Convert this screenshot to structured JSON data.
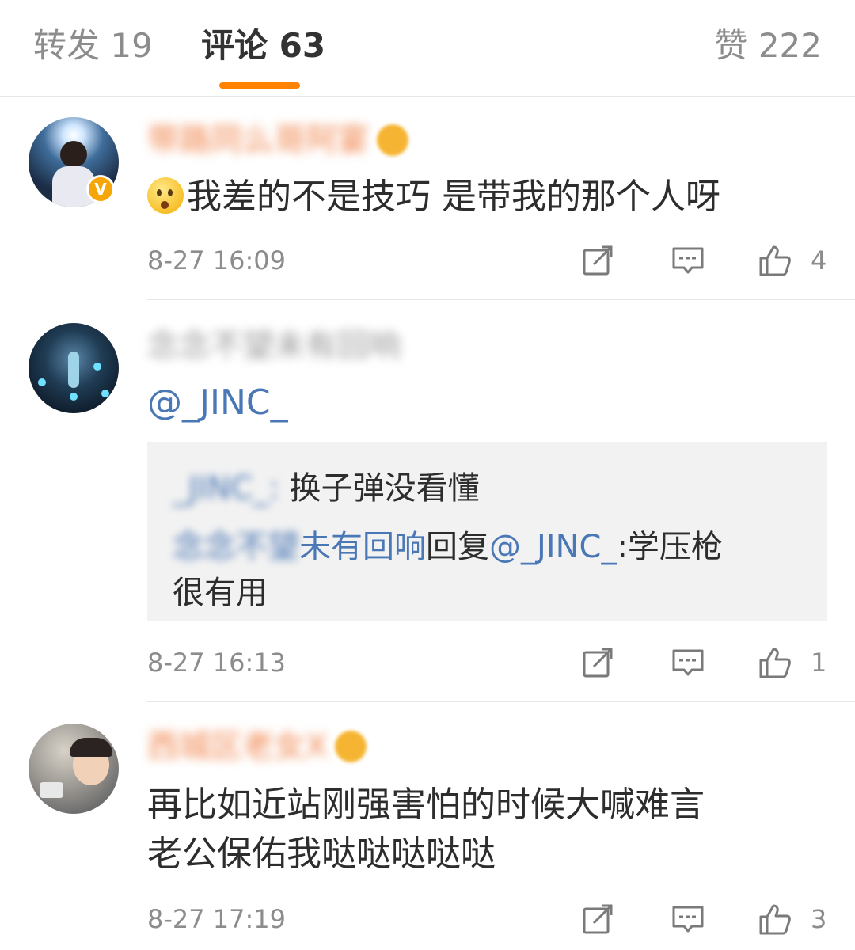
{
  "tabs": {
    "repost": "转发 19",
    "comments": "评论 63",
    "likes": "赞 222",
    "accent_color": "#ff8200"
  },
  "comments": [
    {
      "username": "带路同么哥阿宴",
      "verified_badge": "V",
      "emoji_icon": "thinking-face",
      "text": "我差的不是技巧 是带我的那个人呀",
      "time": "8-27 16:09",
      "like_count": "4"
    },
    {
      "username": "念念不望未有回响",
      "mention": "@_JINC_",
      "quote": {
        "line1_user": "_JINC_:",
        "line1_text": " 换子弹没看懂",
        "line2_user_blur": "念念不望",
        "line2_user_visible": "未有回响",
        "line2_reply": "回复",
        "line2_mention": "@_JINC_",
        "line2_text": ":学压枪",
        "line3_text": "很有用"
      },
      "time": "8-27 16:13",
      "like_count": "1"
    },
    {
      "username": "西城区老女X",
      "text_line1": "再比如近站刚强害怕的时候大喊难言",
      "text_line2": "老公保佑我哒哒哒哒哒",
      "time": "8-27 17:19",
      "like_count": "3"
    }
  ],
  "icons": {
    "repost": "repost-icon",
    "comment": "comment-icon",
    "like": "thumbs-up-icon"
  }
}
